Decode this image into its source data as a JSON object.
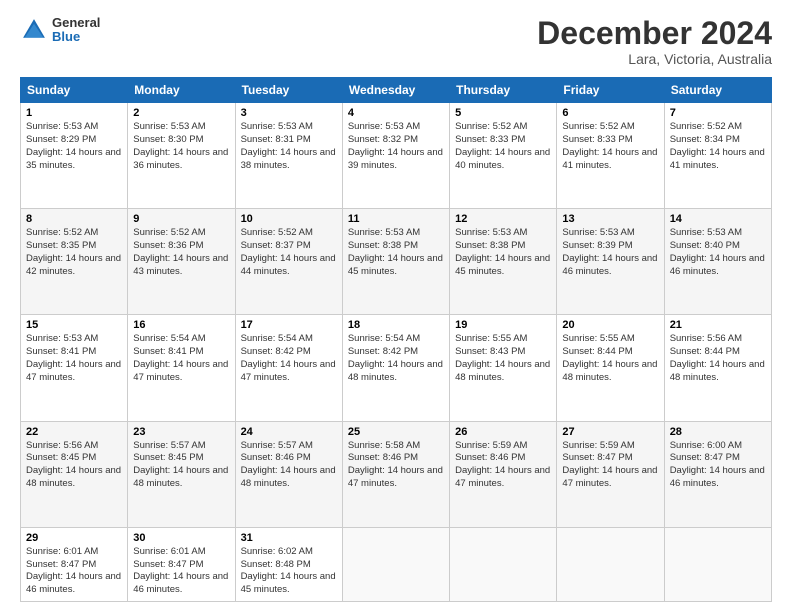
{
  "header": {
    "logo_general": "General",
    "logo_blue": "Blue",
    "month": "December 2024",
    "location": "Lara, Victoria, Australia"
  },
  "weekdays": [
    "Sunday",
    "Monday",
    "Tuesday",
    "Wednesday",
    "Thursday",
    "Friday",
    "Saturday"
  ],
  "weeks": [
    [
      {
        "day": "1",
        "sunrise": "5:53 AM",
        "sunset": "8:29 PM",
        "daylight": "14 hours and 35 minutes."
      },
      {
        "day": "2",
        "sunrise": "5:53 AM",
        "sunset": "8:30 PM",
        "daylight": "14 hours and 36 minutes."
      },
      {
        "day": "3",
        "sunrise": "5:53 AM",
        "sunset": "8:31 PM",
        "daylight": "14 hours and 38 minutes."
      },
      {
        "day": "4",
        "sunrise": "5:53 AM",
        "sunset": "8:32 PM",
        "daylight": "14 hours and 39 minutes."
      },
      {
        "day": "5",
        "sunrise": "5:52 AM",
        "sunset": "8:33 PM",
        "daylight": "14 hours and 40 minutes."
      },
      {
        "day": "6",
        "sunrise": "5:52 AM",
        "sunset": "8:33 PM",
        "daylight": "14 hours and 41 minutes."
      },
      {
        "day": "7",
        "sunrise": "5:52 AM",
        "sunset": "8:34 PM",
        "daylight": "14 hours and 41 minutes."
      }
    ],
    [
      {
        "day": "8",
        "sunrise": "5:52 AM",
        "sunset": "8:35 PM",
        "daylight": "14 hours and 42 minutes."
      },
      {
        "day": "9",
        "sunrise": "5:52 AM",
        "sunset": "8:36 PM",
        "daylight": "14 hours and 43 minutes."
      },
      {
        "day": "10",
        "sunrise": "5:52 AM",
        "sunset": "8:37 PM",
        "daylight": "14 hours and 44 minutes."
      },
      {
        "day": "11",
        "sunrise": "5:53 AM",
        "sunset": "8:38 PM",
        "daylight": "14 hours and 45 minutes."
      },
      {
        "day": "12",
        "sunrise": "5:53 AM",
        "sunset": "8:38 PM",
        "daylight": "14 hours and 45 minutes."
      },
      {
        "day": "13",
        "sunrise": "5:53 AM",
        "sunset": "8:39 PM",
        "daylight": "14 hours and 46 minutes."
      },
      {
        "day": "14",
        "sunrise": "5:53 AM",
        "sunset": "8:40 PM",
        "daylight": "14 hours and 46 minutes."
      }
    ],
    [
      {
        "day": "15",
        "sunrise": "5:53 AM",
        "sunset": "8:41 PM",
        "daylight": "14 hours and 47 minutes."
      },
      {
        "day": "16",
        "sunrise": "5:54 AM",
        "sunset": "8:41 PM",
        "daylight": "14 hours and 47 minutes."
      },
      {
        "day": "17",
        "sunrise": "5:54 AM",
        "sunset": "8:42 PM",
        "daylight": "14 hours and 47 minutes."
      },
      {
        "day": "18",
        "sunrise": "5:54 AM",
        "sunset": "8:42 PM",
        "daylight": "14 hours and 48 minutes."
      },
      {
        "day": "19",
        "sunrise": "5:55 AM",
        "sunset": "8:43 PM",
        "daylight": "14 hours and 48 minutes."
      },
      {
        "day": "20",
        "sunrise": "5:55 AM",
        "sunset": "8:44 PM",
        "daylight": "14 hours and 48 minutes."
      },
      {
        "day": "21",
        "sunrise": "5:56 AM",
        "sunset": "8:44 PM",
        "daylight": "14 hours and 48 minutes."
      }
    ],
    [
      {
        "day": "22",
        "sunrise": "5:56 AM",
        "sunset": "8:45 PM",
        "daylight": "14 hours and 48 minutes."
      },
      {
        "day": "23",
        "sunrise": "5:57 AM",
        "sunset": "8:45 PM",
        "daylight": "14 hours and 48 minutes."
      },
      {
        "day": "24",
        "sunrise": "5:57 AM",
        "sunset": "8:46 PM",
        "daylight": "14 hours and 48 minutes."
      },
      {
        "day": "25",
        "sunrise": "5:58 AM",
        "sunset": "8:46 PM",
        "daylight": "14 hours and 47 minutes."
      },
      {
        "day": "26",
        "sunrise": "5:59 AM",
        "sunset": "8:46 PM",
        "daylight": "14 hours and 47 minutes."
      },
      {
        "day": "27",
        "sunrise": "5:59 AM",
        "sunset": "8:47 PM",
        "daylight": "14 hours and 47 minutes."
      },
      {
        "day": "28",
        "sunrise": "6:00 AM",
        "sunset": "8:47 PM",
        "daylight": "14 hours and 46 minutes."
      }
    ],
    [
      {
        "day": "29",
        "sunrise": "6:01 AM",
        "sunset": "8:47 PM",
        "daylight": "14 hours and 46 minutes."
      },
      {
        "day": "30",
        "sunrise": "6:01 AM",
        "sunset": "8:47 PM",
        "daylight": "14 hours and 46 minutes."
      },
      {
        "day": "31",
        "sunrise": "6:02 AM",
        "sunset": "8:48 PM",
        "daylight": "14 hours and 45 minutes."
      },
      null,
      null,
      null,
      null
    ]
  ]
}
